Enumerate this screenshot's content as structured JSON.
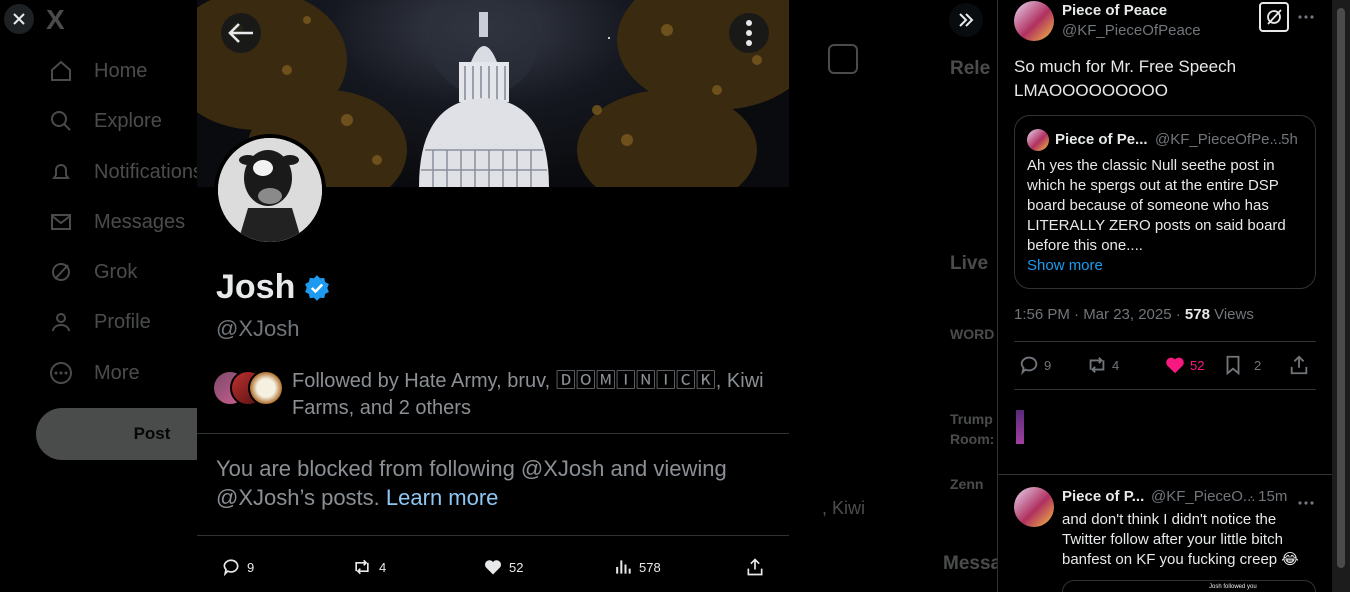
{
  "background_app": {
    "logo": "X",
    "nav": [
      {
        "label": "Home",
        "icon": "home-icon"
      },
      {
        "label": "Explore",
        "icon": "search-icon"
      },
      {
        "label": "Notifications",
        "icon": "bell-icon"
      },
      {
        "label": "Messages",
        "icon": "mail-icon"
      },
      {
        "label": "Grok",
        "icon": "grok-icon"
      },
      {
        "label": "Profile",
        "icon": "person-icon"
      },
      {
        "label": "More",
        "icon": "more-circle-icon"
      }
    ],
    "post_button": "Post",
    "right_headings": [
      "Rele",
      "Live",
      "Messa"
    ],
    "right_snippets": [
      "WORD",
      "Trump",
      "Room:",
      "Zenn",
      ", Kiwi"
    ]
  },
  "profile": {
    "name": "Josh",
    "handle": "@XJosh",
    "followed_by_line1": "Followed by Hate Army, bruv, 🄳🄾🄼🄸🄽🄸🄲🄺, Kiwi",
    "followed_by_line2": "Farms, and 2 others",
    "blocked_text": "You are blocked from following @XJosh and viewing @XJosh’s posts.",
    "learn_more": "Learn more",
    "actions": {
      "replies": "9",
      "reposts": "4",
      "likes": "52",
      "views": "578"
    }
  },
  "tweet": {
    "author_name": "Piece of Peace",
    "author_handle": "@KF_PieceOfPeace",
    "text_line1": "So much for Mr. Free Speech",
    "text_line2": "LMAOOOOOOOOO",
    "quote": {
      "name": "Piece of Pe...",
      "handle": "@KF_PieceOfPe...",
      "time": "· 5h",
      "text": "Ah yes the classic Null seethe post in which he spergs out at the entire DSP board because of someone who has LITERALLY ZERO posts on said board before this one....",
      "show_more": "Show more"
    },
    "meta_time": "1:56 PM · Mar 23, 2025 · ",
    "meta_views": "578",
    "meta_views_label": " Views",
    "actions": {
      "replies": "9",
      "reposts": "4",
      "likes": "52",
      "bookmarks": "2"
    },
    "like_color": "#f91880"
  },
  "reply": {
    "author_name": "Piece of P...",
    "author_handle": "@KF_PieceO...",
    "time": "· 15m",
    "text": "and don't think I didn't notice the Twitter follow after your little bitch banfest on KF you fucking creep 😂",
    "preview_text": "Josh followed you"
  },
  "colors": {
    "accent": "#1d9bf0",
    "link": "#8ec6f4",
    "like": "#f91880",
    "border": "#2f3336",
    "muted": "#71767b"
  }
}
